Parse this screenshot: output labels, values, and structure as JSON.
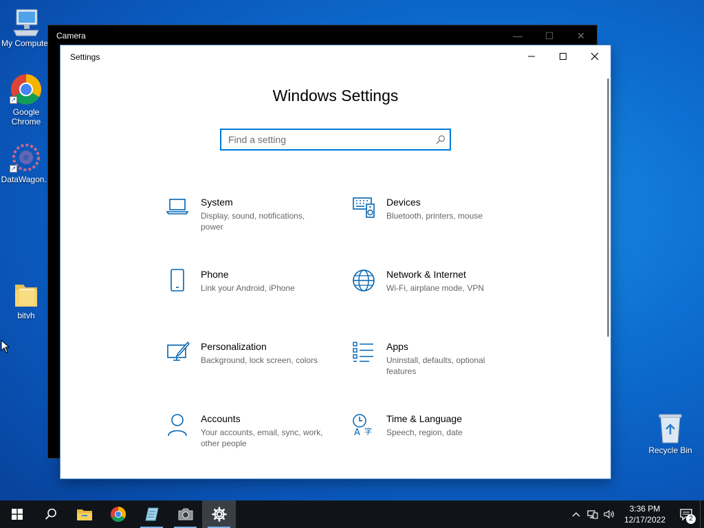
{
  "desktop": {
    "icons": [
      {
        "label": "My Computer"
      },
      {
        "label": "Google Chrome"
      },
      {
        "label": "DataWagon..."
      },
      {
        "label": "bitvh"
      },
      {
        "label": "Recycle Bin"
      }
    ]
  },
  "camera_window": {
    "title": "Camera"
  },
  "settings_window": {
    "title": "Settings",
    "heading": "Windows Settings",
    "search_placeholder": "Find a setting",
    "categories": [
      {
        "name": "System",
        "desc": "Display, sound, notifications, power",
        "icon": "laptop-icon"
      },
      {
        "name": "Devices",
        "desc": "Bluetooth, printers, mouse",
        "icon": "keyboard-speaker-icon"
      },
      {
        "name": "Phone",
        "desc": "Link your Android, iPhone",
        "icon": "phone-icon"
      },
      {
        "name": "Network & Internet",
        "desc": "Wi-Fi, airplane mode, VPN",
        "icon": "globe-icon"
      },
      {
        "name": "Personalization",
        "desc": "Background, lock screen, colors",
        "icon": "paintbrush-icon"
      },
      {
        "name": "Apps",
        "desc": "Uninstall, defaults, optional features",
        "icon": "list-icon"
      },
      {
        "name": "Accounts",
        "desc": "Your accounts, email, sync, work, other people",
        "icon": "person-icon"
      },
      {
        "name": "Time & Language",
        "desc": "Speech, region, date",
        "icon": "time-language-icon"
      }
    ]
  },
  "taskbar": {
    "apps": [
      "start",
      "search",
      "file-explorer",
      "chrome",
      "notepad",
      "camera",
      "settings"
    ],
    "clock_time": "3:36 PM",
    "clock_date": "12/17/2022",
    "notification_count": "2"
  },
  "colors": {
    "accent": "#0078d7",
    "taskbar": "#101418"
  }
}
